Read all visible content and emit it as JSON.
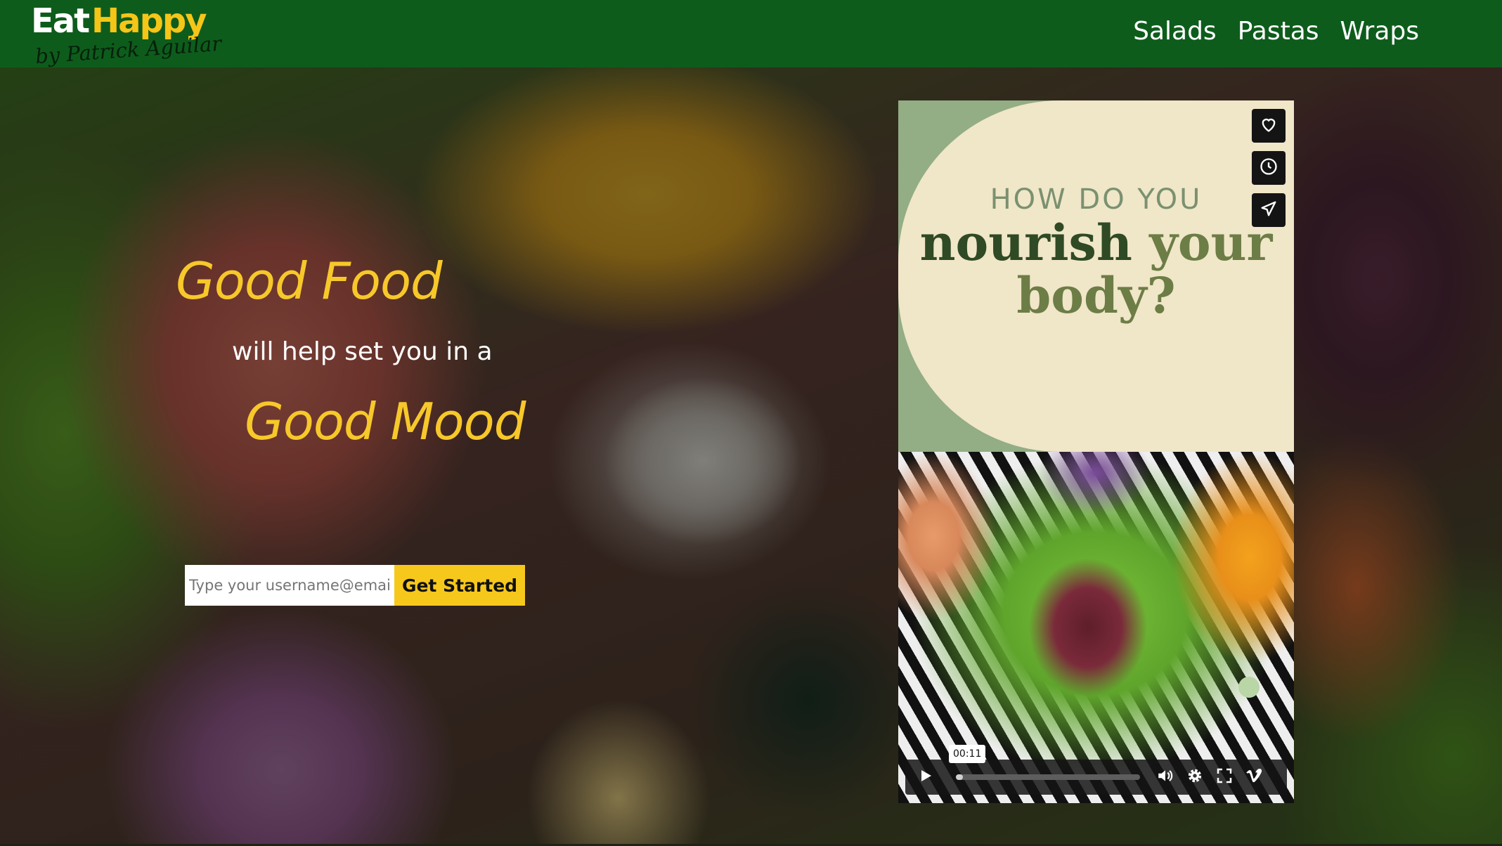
{
  "brand": {
    "name_part1": "Eat",
    "name_part2": "Happy",
    "byline": "by Patrick Aguilar"
  },
  "nav": {
    "items": [
      {
        "label": "Salads"
      },
      {
        "label": "Pastas"
      },
      {
        "label": "Wraps"
      }
    ]
  },
  "hero": {
    "line1": "Good Food",
    "line2": "will help set you in a",
    "line3": "Good Mood",
    "email_placeholder": "Type your username@email.com",
    "cta_label": "Get Started"
  },
  "video": {
    "poster_line1": "HOW DO YOU",
    "poster_line2_a": "nourish",
    "poster_line2_b": "your",
    "poster_line3": "body?",
    "side_buttons": [
      "heart-icon",
      "clock-icon",
      "send-icon"
    ],
    "current_time": "00:11",
    "progress": 0.04,
    "controls": [
      "volume-icon",
      "settings-icon",
      "fullscreen-icon",
      "vimeo-icon"
    ]
  },
  "colors": {
    "header_bg": "#0e5c1c",
    "accent_yellow": "#f7c82a",
    "button_yellow": "#f7c81c",
    "poster_cream": "#f0e6c8",
    "poster_green": "#93ad85"
  }
}
